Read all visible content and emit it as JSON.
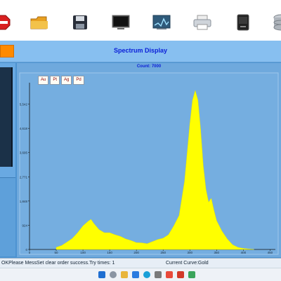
{
  "toolbar": {
    "icons": [
      "stop-icon",
      "folder-icon",
      "save-icon",
      "monitor-icon",
      "spectrum-icon",
      "printer-icon",
      "device-icon",
      "database-icon"
    ]
  },
  "header": {
    "title": "Spectrum Display"
  },
  "chart_header": {
    "count": "Count:    7000"
  },
  "element_buttons": [
    "Au",
    "Pt",
    "Ag",
    "Pd"
  ],
  "chart_data": {
    "type": "area",
    "title": "",
    "xlabel": "",
    "ylabel": "",
    "y_ticks": [
      "5,542",
      "4,618",
      "3,695",
      "2,771",
      "1,848",
      "924",
      "0"
    ],
    "x_ticks": [
      "0",
      "50",
      "100",
      "150",
      "200",
      "250",
      "300",
      "350",
      "400",
      "450"
    ],
    "xlim": [
      0,
      460
    ],
    "ylim": [
      0,
      6200
    ],
    "fill_color": "#ffff00",
    "series": [
      {
        "x": [
          50,
          60,
          70,
          80,
          90,
          100,
          110,
          115,
          120,
          130,
          140,
          150,
          160,
          170,
          180,
          190,
          200,
          210,
          220,
          230,
          240,
          250,
          260,
          270,
          280,
          290,
          300,
          305,
          310,
          315,
          320,
          325,
          330,
          335,
          340,
          345,
          350,
          360,
          370,
          380,
          390,
          400,
          410,
          420
        ],
        "values": [
          80,
          150,
          280,
          420,
          640,
          900,
          1080,
          1150,
          1000,
          760,
          640,
          640,
          560,
          500,
          400,
          340,
          260,
          250,
          220,
          300,
          380,
          430,
          560,
          900,
          1300,
          2600,
          4800,
          5700,
          6060,
          5700,
          4600,
          3200,
          2300,
          1800,
          1950,
          1500,
          1100,
          700,
          400,
          180,
          80,
          40,
          20,
          0
        ]
      }
    ]
  },
  "status": {
    "part1": "OKPlease Mess",
    "part2": "Set clear order success.Try times: 1",
    "part3": "Current Curve:Gold"
  },
  "colors": {
    "accent": "#0a1dd8",
    "panel": "#4d93d1",
    "plot": "#6fa9dd",
    "peak": "#ffff00",
    "button": "#ff8a00"
  }
}
